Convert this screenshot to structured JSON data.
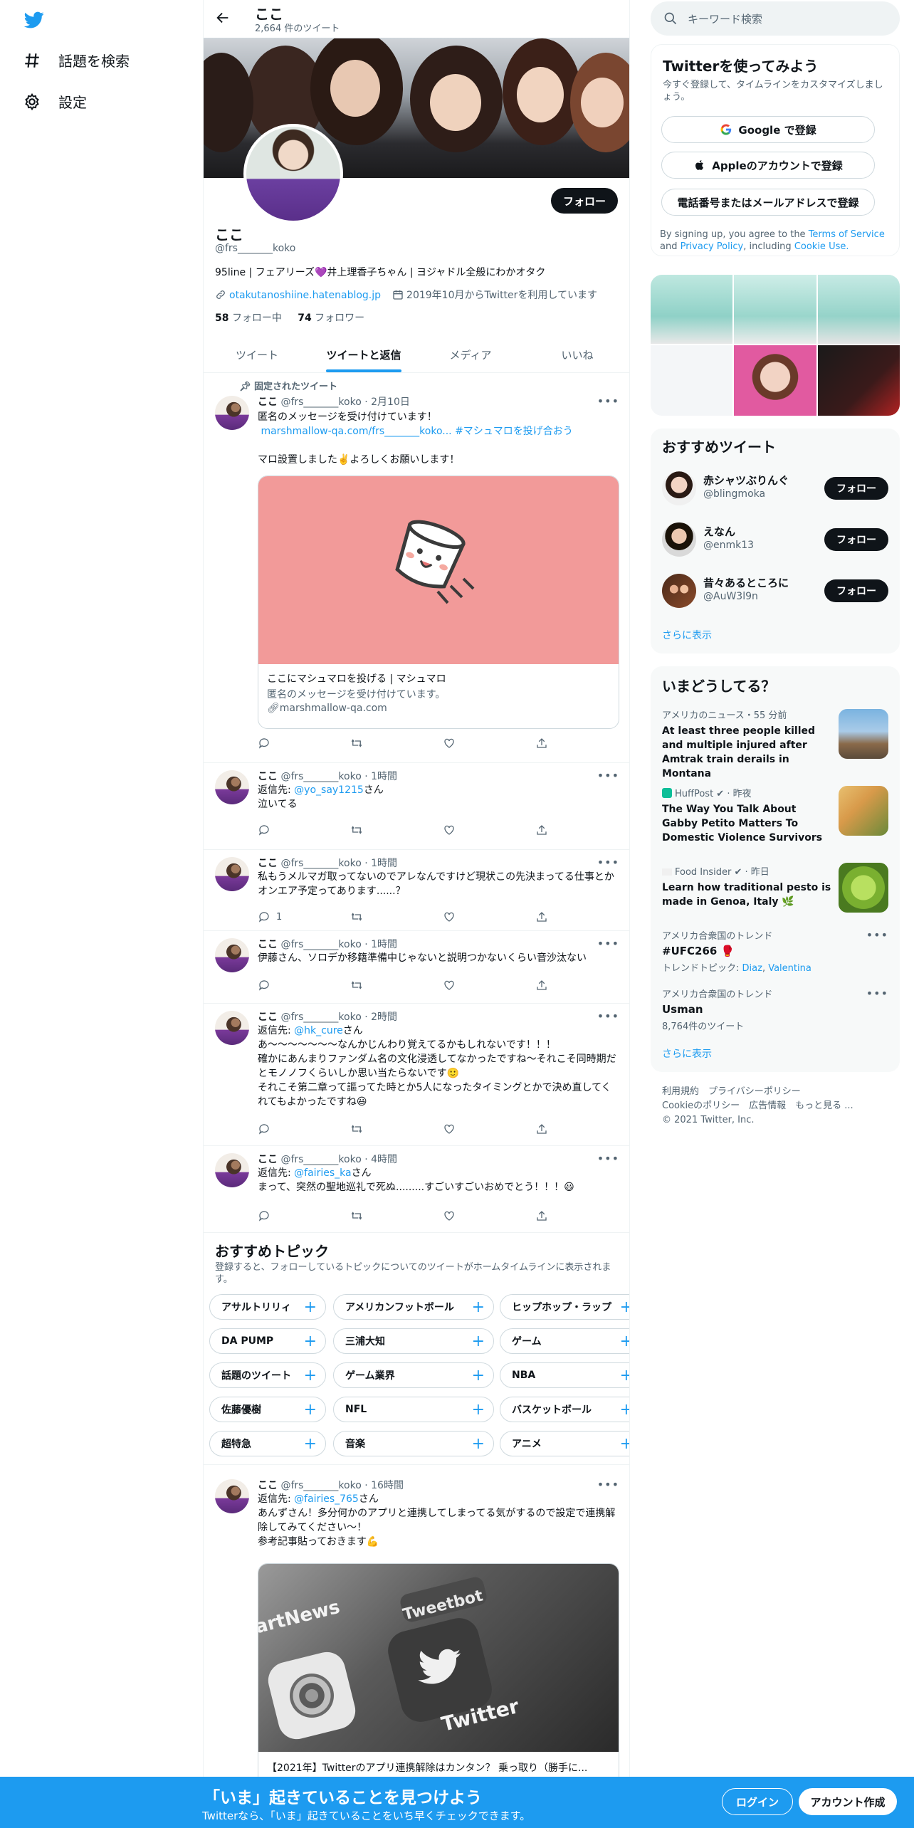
{
  "nav": {
    "explore": "話題を検索",
    "settings": "設定"
  },
  "header": {
    "title": "ここ",
    "tweet_count": "2,664 件のツイート"
  },
  "profile": {
    "name": "ここ",
    "handle": "@frs_______koko",
    "follow": "フォロー",
    "bio": "95line | フェアリーズ💜井上理香子ちゃん | ヨジャドル全般にわかオタク",
    "link": "otakutanoshiine.hatenablog.jp",
    "joined": "2019年10月からTwitterを利用しています",
    "following_count": "58",
    "following_label": "フォロー中",
    "followers_count": "74",
    "followers_label": "フォロワー"
  },
  "tabs": [
    "ツイート",
    "ツイートと返信",
    "メディア",
    "いいね"
  ],
  "pinned_label": "固定されたツイート",
  "tweets": [
    {
      "name": "ここ",
      "handle": "@frs_______koko",
      "time": "2月10日",
      "line1": "匿名のメッセージを受け付けています！",
      "link": "marshmallow-qa.com/frs_______koko...",
      "hashtag": "#マシュマロを投げ合おう",
      "line2": "マロ設置しました✌️よろしくお願いします！",
      "card_title": "ここにマシュマロを投げる | マシュマロ",
      "card_desc": "匿名のメッセージを受け付けています。",
      "card_domain": "marshmallow-qa.com"
    },
    {
      "name": "ここ",
      "handle": "@frs_______koko",
      "time": "1時間",
      "reply_prefix": "返信先: ",
      "reply_to": "@yo_say1215",
      "reply_suffix": "さん",
      "text": "泣いてる"
    },
    {
      "name": "ここ",
      "handle": "@frs_______koko",
      "time": "1時間",
      "text": "私もうメルマガ取ってないのでアレなんですけど現状この先決まってる仕事とかオンエア予定ってあります......？",
      "reply_count": "1"
    },
    {
      "name": "ここ",
      "handle": "@frs_______koko",
      "time": "1時間",
      "text": "伊藤さん、ソロデか移籍準備中じゃないと説明つかないくらい音沙汰ない"
    },
    {
      "name": "ここ",
      "handle": "@frs_______koko",
      "time": "2時間",
      "reply_prefix": "返信先: ",
      "reply_to": "@hk_cure",
      "reply_suffix": "さん",
      "text1": "あ〜〜〜〜〜〜〜なんかじんわり覚えてるかもしれないです！！！",
      "text2": "確かにあんまりファンダム名の文化浸透してなかったですね〜それこそ同時期だとモノノフくらいしか思い当たらないです🙂",
      "text3": "それこそ第二章って謳ってた時とか5人になったタイミングとかで決め直してくれてもよかったですね😃"
    },
    {
      "name": "ここ",
      "handle": "@frs_______koko",
      "time": "4時間",
      "reply_prefix": "返信先: ",
      "reply_to": "@fairies_ka",
      "reply_suffix": "さん",
      "text": "まって、突然の聖地巡礼で死ぬ.........すごいすごいおめでとう！！！😃"
    },
    {
      "name": "ここ",
      "handle": "@frs_______koko",
      "time": "16時間",
      "reply_prefix": "返信先: ",
      "reply_to": "@fairies_765",
      "reply_suffix": "さん",
      "text1": "あんずさん！多分何かのアプリと連携してしまってる気がするので設定で連携解除してみてください〜！",
      "text2": "参考記事貼っておきます💪",
      "card_title": "【2021年】Twitterのアプリ連携解除はカンタン？ 乗っ取り（勝手に...",
      "card_img_text1": "Tweetbot",
      "card_img_text2": "Twitter",
      "card_img_text3": "artNews"
    }
  ],
  "topics": {
    "title": "おすすめトピック",
    "desc": "登録すると、フォローしているトピックについてのツイートがホームタイムラインに表示されます。",
    "col1": [
      "アサルトリリィ",
      "DA PUMP",
      "話題のツイート",
      "佐藤優樹",
      "超特急"
    ],
    "col2": [
      "アメリカンフットボール",
      "三浦大知",
      "ゲーム業界",
      "NFL",
      "音楽"
    ],
    "col3": [
      "ヒップホップ・ラップ",
      "ゲーム",
      "NBA",
      "バスケットボール",
      "アニメ"
    ]
  },
  "search": {
    "placeholder": "キーワード検索"
  },
  "signup": {
    "title": "Twitterを使ってみよう",
    "desc": "今すぐ登録して、タイムラインをカスタマイズしましょう。",
    "google": "Google で登録",
    "apple": "Appleのアカウントで登録",
    "phone": "電話番号またはメールアドレスで登録",
    "legal_pre": "By signing up, you agree to the ",
    "tos": "Terms of Service",
    "and": " and ",
    "privacy": "Privacy Policy",
    "including": ", including ",
    "cookie": "Cookie Use."
  },
  "recommended": {
    "title": "おすすめツイート",
    "users": [
      {
        "name": "赤シャツぶりんぐ",
        "handle": "@blingmoka"
      },
      {
        "name": "えなん",
        "handle": "@enmk13"
      },
      {
        "name": "昔々あるところに",
        "handle": "@AuW3l9n"
      }
    ],
    "follow": "フォロー",
    "more": "さらに表示"
  },
  "trends": {
    "title": "いまどうしてる？",
    "items": [
      {
        "meta": "アメリカのニュース・55 分前",
        "text": "At least three people killed and multiple injured after Amtrak train derails in Montana"
      },
      {
        "meta": "HuffPost ✔ · 昨夜",
        "text": "The Way You Talk About Gabby Petito Matters To Domestic Violence Survivors"
      },
      {
        "meta": "Food Insider ✔ · 昨日",
        "text": "Learn how traditional pesto is made in Genoa, Italy 🌿"
      }
    ],
    "t1_meta": "アメリカ合衆国のトレンド",
    "t1_name": "#UFC266 🥊",
    "t1_topic_label": "トレンドトピック: ",
    "t1_topic1": "Diaz",
    "t1_topic2": "Valentina",
    "t2_meta": "アメリカ合衆国のトレンド",
    "t2_name": "Usman",
    "t2_count": "8,764件のツイート",
    "more": "さらに表示"
  },
  "footer": {
    "line1": "利用規約　プライバシーポリシー",
    "line2": "Cookieのポリシー　広告情報　もっと見る ...",
    "line3": "© 2021 Twitter, Inc."
  },
  "bottombar": {
    "title": "「いま」起きていることを見つけよう",
    "sub": "Twitterなら、「いま」起きていることをいち早くチェックできます。",
    "login": "ログイン",
    "signup": "アカウント作成"
  },
  "colors": {
    "accent": "#1d9bf0",
    "text": "#0f1419",
    "muted": "#536471",
    "marshmallow_card": "#f29a99"
  }
}
